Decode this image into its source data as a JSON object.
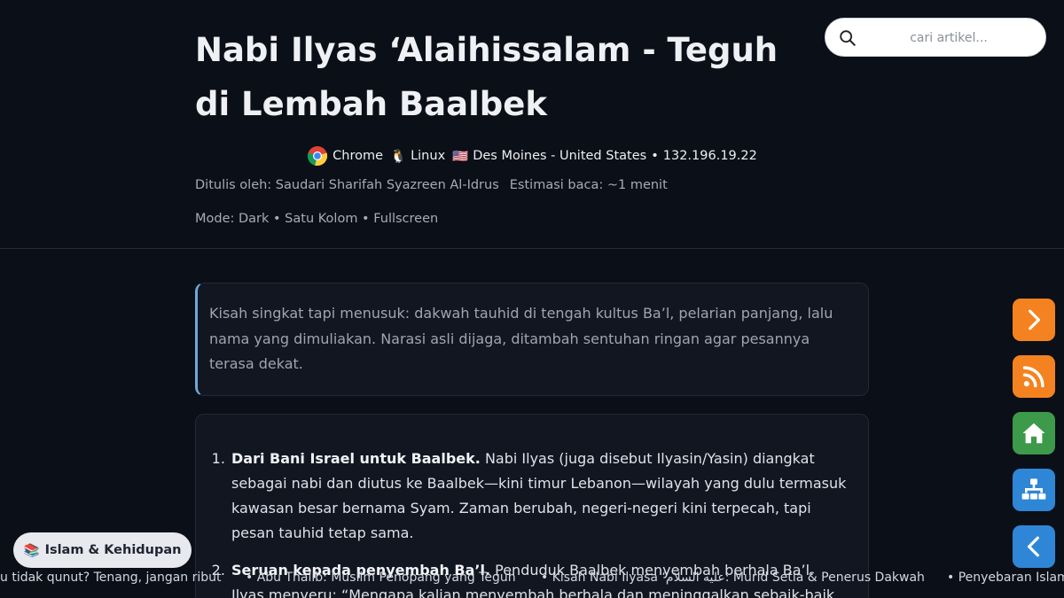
{
  "article": {
    "title": "Nabi Ilyas ‘Alaihissalam - Teguh di Lembah Baalbek",
    "author": "Ditulis oleh: Saudari Sharifah Syazreen Al-Idrus",
    "reading_time": "Estimasi baca: ~1 menit",
    "mode": "Mode: Dark • Satu Kolom • Fullscreen",
    "intro": "Kisah singkat tapi menusuk: dakwah tauhid di tengah kultus Ba’l, pelarian panjang, lalu nama yang dimuliakan. Narasi asli dijaga, ditambah sentuhan ringan agar pesannya terasa dekat.",
    "points": [
      {
        "heading": "Dari Bani Israel untuk Baalbek.",
        "text": " Nabi Ilyas (juga disebut Ilyasin/Yasin) diangkat sebagai nabi dan diutus ke Baalbek—kini timur Lebanon—wilayah yang dulu termasuk kawasan besar bernama Syam. Zaman berubah, negeri-negeri kini terpecah, tapi pesan tauhid tetap sama."
      },
      {
        "heading": "Seruan kepada penyembah Ba’l.",
        "text": " Penduduk Baalbek menyembah berhala Ba’l. Ilyas menyeru: “Mengapa kalian menyembah berhala dan meninggalkan sebaik-baik"
      }
    ]
  },
  "search": {
    "placeholder": "cari artikel..."
  },
  "env": {
    "browser": "Chrome",
    "os": "Linux",
    "location": "Des Moines - United States",
    "ip_sep": "•",
    "ip": "132.196.19.22",
    "flag": "🇺🇸",
    "os_icon": "🐧"
  },
  "category": {
    "icon": "📚",
    "label": "Islam & Kehidupan"
  },
  "side_buttons": [
    {
      "name": "next",
      "color": "#f58220"
    },
    {
      "name": "rss",
      "color": "#f58220"
    },
    {
      "name": "home",
      "color": "#3c9a4a"
    },
    {
      "name": "sitemap",
      "color": "#2f86d6"
    },
    {
      "name": "back",
      "color": "#2f86d6"
    }
  ],
  "ticker": [
    "u tidak qunut? Tenang, jangan ribut",
    "• Abu Thalib: Muslim Penopang yang Teguh",
    "• Kisah Nabi Ilyasa ‘عليه السلام: Murid Setia & Penerus Dakwah",
    "• Penyebaran Islam"
  ]
}
